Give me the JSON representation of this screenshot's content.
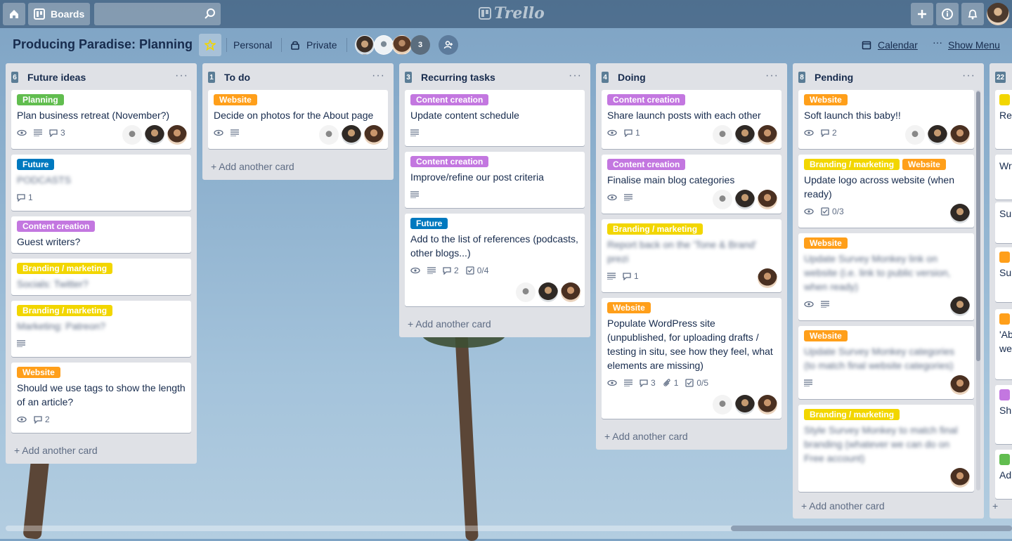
{
  "app": {
    "logo_text": "Trello",
    "boards_label": "Boards",
    "search_placeholder": ""
  },
  "board": {
    "title": "Producing Paradise: Planning",
    "team": "Personal",
    "visibility": "Private",
    "member_count": "3",
    "calendar": "Calendar",
    "show_menu": "Show Menu"
  },
  "lists": [
    {
      "count": "6",
      "title": "Future ideas",
      "add": "+ Add another card",
      "cards": [
        {
          "labels": [
            {
              "text": "Planning",
              "color": "green"
            }
          ],
          "text": "Plan business retreat (November?)",
          "comments": "3"
        },
        {
          "labels": [
            {
              "text": "Future",
              "color": "blue"
            }
          ],
          "text": "PODCASTS",
          "comments": "1"
        },
        {
          "labels": [
            {
              "text": "Content creation",
              "color": "purple"
            }
          ],
          "text": "Guest writers?"
        },
        {
          "labels": [
            {
              "text": "Branding / marketing",
              "color": "yellow"
            }
          ],
          "text": "Socials: Twitter?"
        },
        {
          "labels": [
            {
              "text": "Branding / marketing",
              "color": "yellow"
            }
          ],
          "text": "Marketing: Patreon?"
        },
        {
          "labels": [
            {
              "text": "Website",
              "color": "orange"
            }
          ],
          "text": "Should we use tags to show the length of an article?",
          "comments": "2"
        }
      ]
    },
    {
      "count": "1",
      "title": "To do",
      "add": "+ Add another card",
      "cards": [
        {
          "labels": [
            {
              "text": "Website",
              "color": "orange"
            }
          ],
          "text": "Decide on photos for the About page"
        }
      ]
    },
    {
      "count": "3",
      "title": "Recurring tasks",
      "add": "+ Add another card",
      "cards": [
        {
          "labels": [
            {
              "text": "Content creation",
              "color": "purple"
            }
          ],
          "text": "Update content schedule"
        },
        {
          "labels": [
            {
              "text": "Content creation",
              "color": "purple"
            }
          ],
          "text": "Improve/refine our post criteria"
        },
        {
          "labels": [
            {
              "text": "Future",
              "color": "blue"
            }
          ],
          "text": "Add to the list of references (podcasts, other blogs...)",
          "comments": "2",
          "checklist": "0/4"
        }
      ]
    },
    {
      "count": "4",
      "title": "Doing",
      "add": "+ Add another card",
      "cards": [
        {
          "labels": [
            {
              "text": "Content creation",
              "color": "purple"
            }
          ],
          "text": "Share launch posts with each other",
          "comments": "1"
        },
        {
          "labels": [
            {
              "text": "Content creation",
              "color": "purple"
            }
          ],
          "text": "Finalise main blog categories"
        },
        {
          "labels": [
            {
              "text": "Branding / marketing",
              "color": "yellow"
            }
          ],
          "text": "Report back on the 'Tone & Brand' prezi",
          "comments": "1"
        },
        {
          "labels": [
            {
              "text": "Website",
              "color": "orange"
            }
          ],
          "text": "Populate WordPress site (unpublished, for uploading drafts / testing in situ, see how they feel, what elements are missing)",
          "comments": "3",
          "attachments": "1",
          "checklist": "0/5"
        }
      ]
    },
    {
      "count": "8",
      "title": "Pending",
      "add": "+ Add another card",
      "cards": [
        {
          "labels": [
            {
              "text": "Website",
              "color": "orange"
            }
          ],
          "text": "Soft launch this baby!!",
          "comments": "2"
        },
        {
          "labels": [
            {
              "text": "Branding / marketing",
              "color": "yellow"
            },
            {
              "text": "Website",
              "color": "orange"
            }
          ],
          "text": "Update logo across website (when ready)",
          "checklist": "0/3"
        },
        {
          "labels": [
            {
              "text": "Website",
              "color": "orange"
            }
          ],
          "text": "Update Survey Monkey link on website (i.e. link to public version, when ready)"
        },
        {
          "labels": [
            {
              "text": "Website",
              "color": "orange"
            }
          ],
          "text": "Update Survey Monkey categories (to match final website categories)"
        },
        {
          "labels": [
            {
              "text": "Branding / marketing",
              "color": "yellow"
            }
          ],
          "text": "Style Survey Monkey to match final branding (whatever we can do on Free account)"
        }
      ]
    },
    {
      "count": "22",
      "title": "",
      "add": "+",
      "peek": [
        "Re",
        "Wr",
        "Su",
        "Su",
        "'Ab",
        "we",
        "Sh",
        "Ad"
      ]
    }
  ],
  "colors": {
    "green": "#61bd4f",
    "orange": "#ff9f1a",
    "blue": "#0079bf",
    "purple": "#c377e0",
    "yellow": "#f2d600"
  }
}
